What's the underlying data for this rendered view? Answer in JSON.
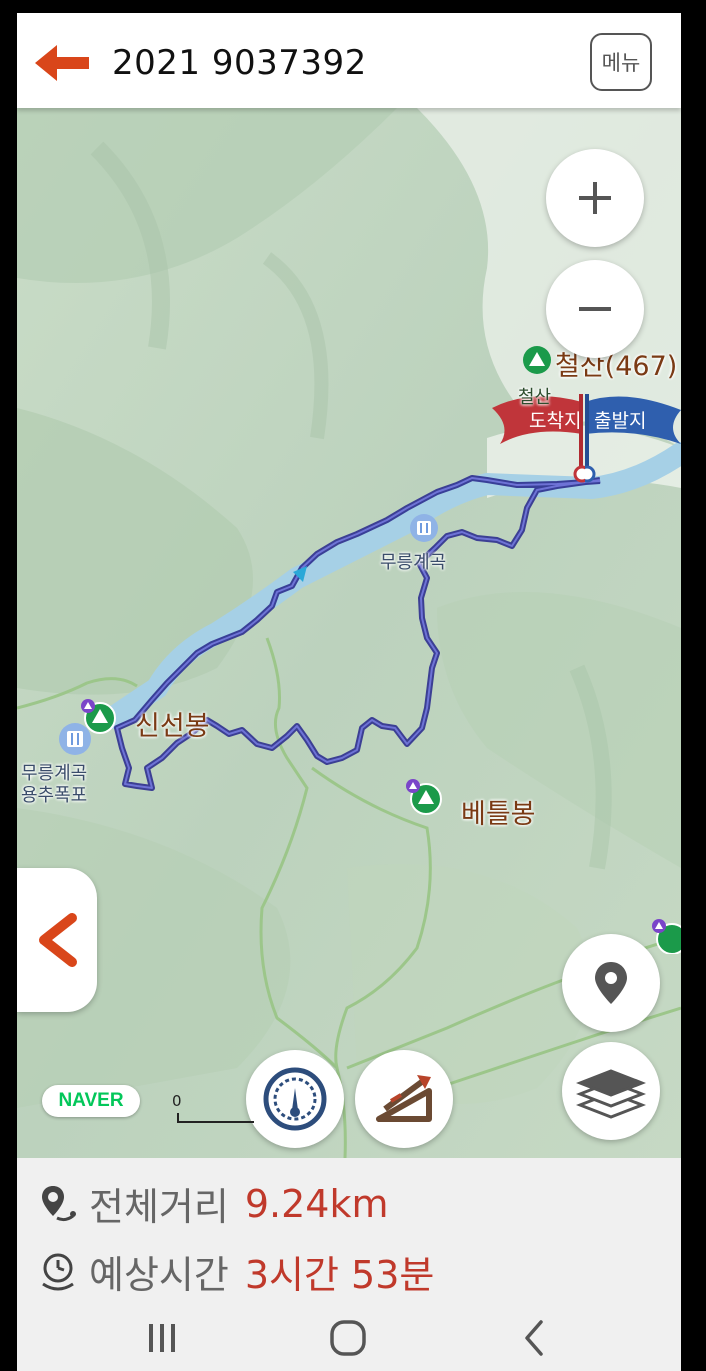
{
  "header": {
    "title": "2021 9037392",
    "menu_label": "메뉴"
  },
  "map": {
    "peaks": {
      "cheolsan": "철산(467)",
      "sinseonbong": "신선봉",
      "beteulbong": "베틀봉"
    },
    "labels": {
      "cheolsan_small": "철산",
      "mureung_valley": "무릉계곡",
      "mureung_falls_line1": "무릉계곡",
      "mureung_falls_line2": "용추폭포"
    },
    "flags": {
      "arrival": "도착지",
      "departure": "출발지"
    },
    "scale_label": "0",
    "brand": "NAVER"
  },
  "summary": {
    "distance_label": "전체거리",
    "distance_value": "9.24km",
    "time_label": "예상시간",
    "time_value": "3시간 53분"
  },
  "colors": {
    "accent": "#c0392b",
    "route": "#3b3fa8",
    "arrival_flag": "#c0353a",
    "departure_flag": "#2f5fae",
    "naver": "#03c75a"
  }
}
